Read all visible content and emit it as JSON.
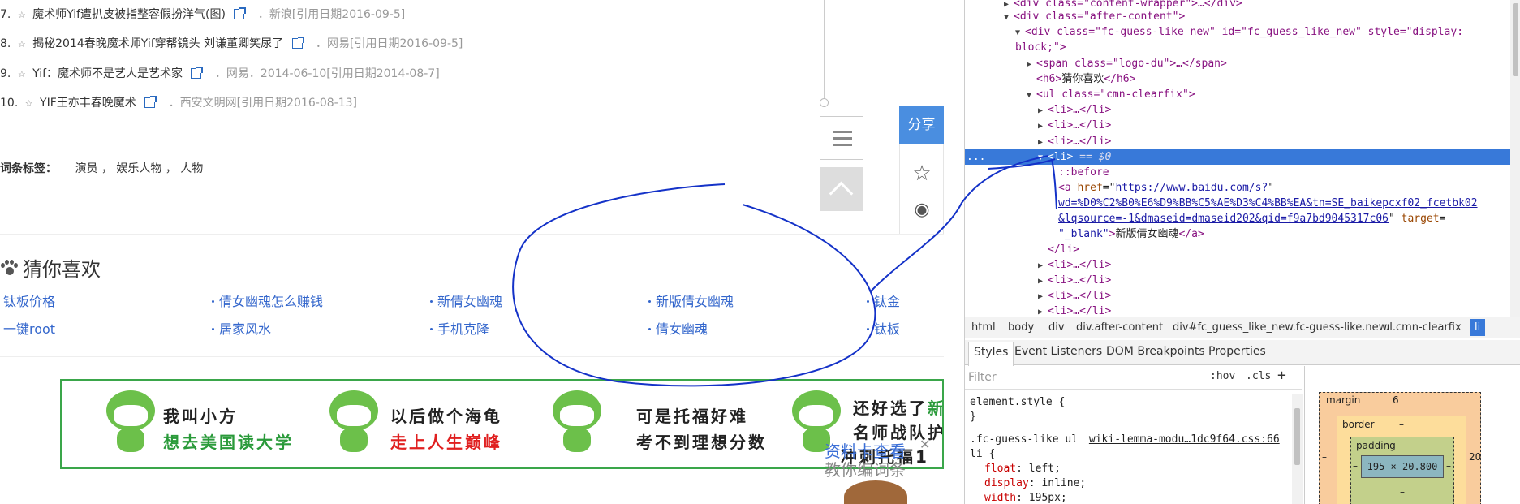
{
  "page": {
    "references": [
      {
        "num": "7.",
        "text": "魔术师Yif遭扒皮被指整容假扮洋气(图)",
        "source": "新浪[引用日期2016-09-5]"
      },
      {
        "num": "8.",
        "text": "揭秘2014春晚魔术师Yif穿帮镜头 刘谦董卿笑尿了",
        "source": "网易[引用日期2016-09-5]"
      },
      {
        "num": "9.",
        "text": "Yif：魔术师不是艺人是艺术家",
        "source": "网易．2014-06-10[引用日期2014-08-7]"
      },
      {
        "num": "10.",
        "text": "YIF王亦丰春晚魔术",
        "source": "西安文明网[引用日期2016-08-13]"
      }
    ],
    "source_sep": "．",
    "tags_label": "词条标签：",
    "tags_value": "演员 ， 娱乐人物 ， 人物",
    "share_label": "分享",
    "guess_title": "猜你喜欢",
    "guess_items": [
      "钛板价格",
      "倩女幽魂怎么赚钱",
      "新倩女幽魂",
      "新版倩女幽魂",
      "钛金",
      "一键root",
      "居家风水",
      "手机克隆",
      "倩女幽魂",
      "钛板"
    ],
    "banner": {
      "t1": "我叫小方",
      "t2": "想去美国读大学",
      "t3": "以后做个海龟",
      "t4": "走上人生巅峰",
      "t5": "可是托福好难",
      "t6": "考不到理想分数",
      "t7": "还好选了",
      "t7b": "新",
      "t8": "名师战队护",
      "t9": "冲刺托福1"
    },
    "overlay_blue": "资料卡查看",
    "overlay_gray": "教你编词条",
    "close_glyph": "✕"
  },
  "devtools": {
    "lines": [
      {
        "indent": 4,
        "tri": "▶",
        "html": "div_content_wrapper"
      },
      {
        "indent": 4,
        "tri": "▼",
        "html": "div_after_content"
      },
      {
        "indent": 5,
        "tri": "▼",
        "html": "div_fc_guess"
      },
      {
        "indent": 5,
        "tri": "",
        "html": "block_cont"
      },
      {
        "indent": 6,
        "tri": "▶",
        "html": "span_logo"
      },
      {
        "indent": 6,
        "tri": "",
        "html": "h6"
      },
      {
        "indent": 6,
        "tri": "▼",
        "html": "ul"
      },
      {
        "indent": 7,
        "tri": "▶",
        "html": "li"
      },
      {
        "indent": 7,
        "tri": "▶",
        "html": "li"
      },
      {
        "indent": 7,
        "tri": "▶",
        "html": "li"
      },
      {
        "indent": 7,
        "tri": "▼",
        "html": "li_sel"
      },
      {
        "indent": 8,
        "tri": "",
        "html": "before"
      },
      {
        "indent": 8,
        "tri": "",
        "html": "a_href"
      },
      {
        "indent": 8,
        "tri": "",
        "html": "a_href2"
      },
      {
        "indent": 8,
        "tri": "",
        "html": "a_href3"
      },
      {
        "indent": 8,
        "tri": "",
        "html": "a_close"
      },
      {
        "indent": 7,
        "tri": "",
        "html": "li_close"
      },
      {
        "indent": 7,
        "tri": "▶",
        "html": "li"
      },
      {
        "indent": 7,
        "tri": "▶",
        "html": "li"
      },
      {
        "indent": 7,
        "tri": "▶",
        "html": "li"
      },
      {
        "indent": 7,
        "tri": "▶",
        "html": "li"
      }
    ],
    "strings": {
      "div_content_wrapper": "<div class=\"content-wrapper\">…</div>",
      "after_content": "<div class=\"after-content\">",
      "fc_guess": "<div class=\"fc-guess-like new\" id=\"fc_guess_like_new\" style=\"display:",
      "block": "block;\">",
      "span_logo": "<span class=\"logo-du\">…</span>",
      "h6_text": "猜你喜欢",
      "ul": "<ul class=\"cmn-clearfix\">",
      "li_collapsed": "<li>…</li>",
      "li_open": "<li>",
      "dollar": " == $0",
      "before": "::before",
      "href1": "https://www.baidu.com/s?",
      "href2": "wd=%D0%C2%B0%E6%D9%BB%C5%AE%D3%C4%BB%EA&tn=SE_baikepcxf02_fcetbk02",
      "href3": "&lqsource=-1&dmaseid=dmaseid202&qid=f9a7bd9045317c06",
      "target": "\"_blank\"",
      "a_text": "新版倩女幽魂",
      "li_close": "</li>",
      "ellipsis": "..."
    },
    "crumbs": [
      "html",
      "body",
      "div",
      "div.after-content",
      "div#fc_guess_like_new.fc-guess-like.new",
      "ul.cmn-clearfix",
      "li"
    ],
    "tabs": [
      "Styles",
      "Event Listeners",
      "DOM Breakpoints",
      "Properties"
    ],
    "filter_placeholder": "Filter",
    "hov": ":hov",
    "cls": ".cls",
    "plus": "+",
    "css": {
      "element_style": "element.style {",
      "close": "}",
      "rule_sel": ".fc-guess-like ul",
      "rule_src": "wiki-lemma-modu…1dc9f64.css:66",
      "rule_sel2": "li {",
      "p1": "float",
      "v1": "left;",
      "p2": "display",
      "v2": "inline;",
      "p3": "width",
      "v3": "195px;"
    },
    "boxmodel": {
      "margin": "margin",
      "margin_val": "6",
      "border": "border",
      "border_val": "–",
      "padding": "padding",
      "padding_val": "–",
      "content": "195 × 20.800",
      "side_left": "–",
      "side_right": "–",
      "right_num": "20",
      "bottom": "–",
      "outer_left": "–"
    }
  }
}
